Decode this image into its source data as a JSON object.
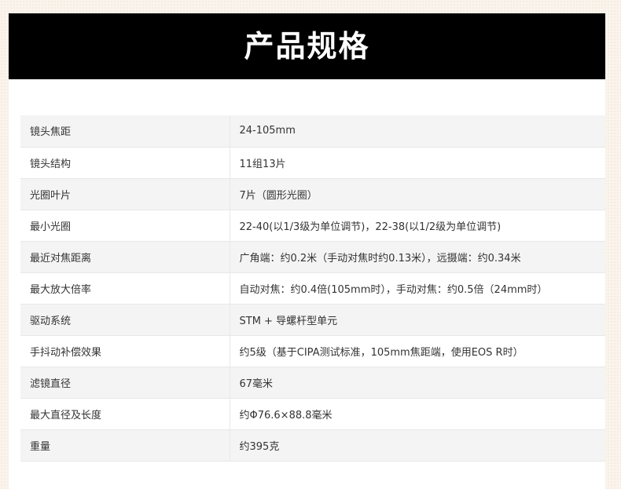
{
  "header": {
    "title": "产品规格"
  },
  "specs": [
    {
      "label": "镜头焦距",
      "value": "24-105mm"
    },
    {
      "label": "镜头结构",
      "value": "11组13片"
    },
    {
      "label": "光圈叶片",
      "value": "7片（圆形光圈）"
    },
    {
      "label": "最小光圈",
      "value": "22-40(以1/3级为单位调节)，22-38(以1/2级为单位调节)"
    },
    {
      "label": "最近对焦距离",
      "value": "广角端：约0.2米（手动对焦时约0.13米），远摄端：约0.34米"
    },
    {
      "label": "最大放大倍率",
      "value": "自动对焦：约0.4倍(105mm时），手动对焦：约0.5倍（24mm时）"
    },
    {
      "label": "驱动系统",
      "value": "STM + 导螺杆型单元"
    },
    {
      "label": "手抖动补偿效果",
      "value": "约5级（基于CIPA测试标准，105mm焦距端，使用EOS R时）"
    },
    {
      "label": "滤镜直径",
      "value": "67毫米"
    },
    {
      "label": "最大直径及长度",
      "value": "约Φ76.6×88.8毫米"
    },
    {
      "label": "重量",
      "value": "约395克"
    }
  ],
  "colors": {
    "header_background": "#000000",
    "header_text": "#ffffff",
    "row_alt_background": "#f4f4f4",
    "page_background": "#fbf4ec"
  }
}
